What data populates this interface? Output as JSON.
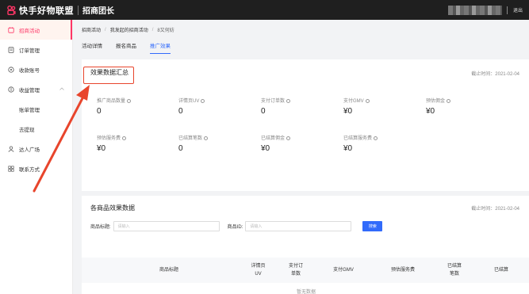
{
  "header": {
    "brand": "快手好物联盟",
    "subtitle": "招商团长",
    "logout": "退出",
    "brand_color": "#fe3666"
  },
  "sidebar": {
    "items": [
      {
        "label": "招商活动",
        "icon": "calendar-icon",
        "active": true
      },
      {
        "label": "订单管理",
        "icon": "order-icon"
      },
      {
        "label": "收款账号",
        "icon": "account-icon"
      },
      {
        "label": "收益管理",
        "icon": "income-icon"
      },
      {
        "label": "账单管理",
        "sub": true
      },
      {
        "label": "去提现",
        "sub": true
      },
      {
        "label": "达人广场",
        "icon": "user-icon"
      },
      {
        "label": "联系方式",
        "icon": "grid-icon"
      }
    ]
  },
  "breadcrumb": [
    "招商活动",
    "我发起的招商活动",
    "8又何妨"
  ],
  "tabs": [
    {
      "label": "活动详情"
    },
    {
      "label": "报名商品"
    },
    {
      "label": "推广效果",
      "active": true
    }
  ],
  "summary": {
    "title": "效果数据汇总",
    "deadline": "截止时间：2021-02-04",
    "metrics": [
      {
        "label": "推广商品数量",
        "value": "0"
      },
      {
        "label": "详情页UV",
        "value": "0"
      },
      {
        "label": "支付订单数",
        "value": "0"
      },
      {
        "label": "支付GMV",
        "value": "¥0"
      },
      {
        "label": "预估佣金",
        "value": "¥0"
      },
      {
        "label": "预估服务费",
        "value": "¥0"
      },
      {
        "label": "已结算笔数",
        "value": "0"
      },
      {
        "label": "已结算佣金",
        "value": "¥0"
      },
      {
        "label": "已结算服务费",
        "value": "¥0"
      }
    ]
  },
  "products": {
    "title": "各商品效果数据",
    "deadline": "截止时间：2021-02-04",
    "filters": {
      "title_label": "商品标题:",
      "title_placeholder": "请输入",
      "id_label": "商品ID:",
      "id_placeholder": "请输入",
      "search_button": "搜索"
    },
    "columns": [
      "商品标题",
      "详情页\nUV",
      "支付订\n单数",
      "支付GMV",
      "预估服务费",
      "已结算\n笔数",
      "已结算"
    ],
    "empty_text": "暂无数据"
  },
  "colors": {
    "accent": "#326bfb",
    "annotation": "#e8452c"
  }
}
